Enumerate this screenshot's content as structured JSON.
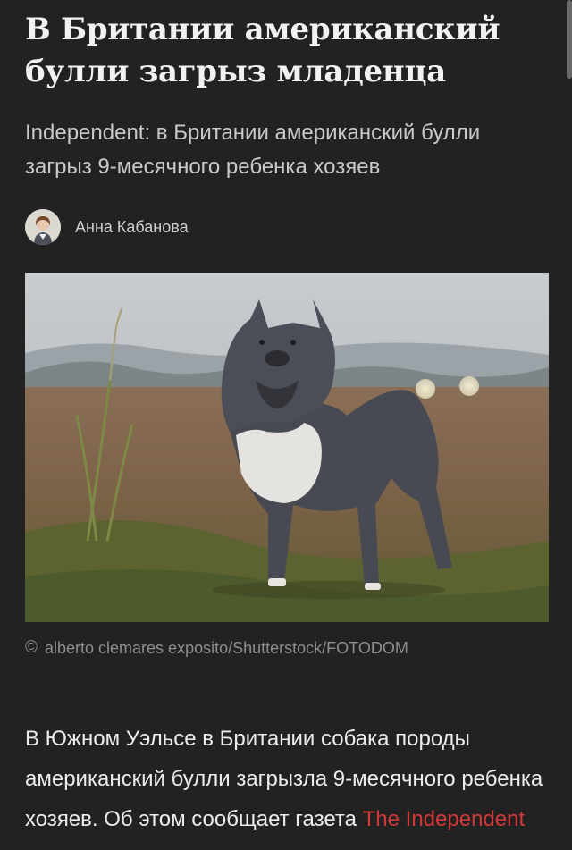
{
  "article": {
    "headline": "В Британии американский булли загрыз младенца",
    "lead": "Independent: в Британии американский булли загрыз 9-месячного ребенка хозяев",
    "author": {
      "name": "Анна Кабанова",
      "avatar_icon": "author-avatar"
    },
    "image": {
      "caption": "alberto clemares exposito/Shutterstock/FOTODOM",
      "copyright_symbol": "©"
    },
    "body": {
      "text": "В Южном Уэльсе в Британии собака породы американский булли загрызла 9-месячного ребенка хозяев. Об этом сообщает газета",
      "link_text": "The Independent"
    }
  },
  "colors": {
    "background": "#222222",
    "headline": "#f2f2f2",
    "lead": "#c9c9c9",
    "caption": "#8f8f8f",
    "link": "#d33838"
  }
}
